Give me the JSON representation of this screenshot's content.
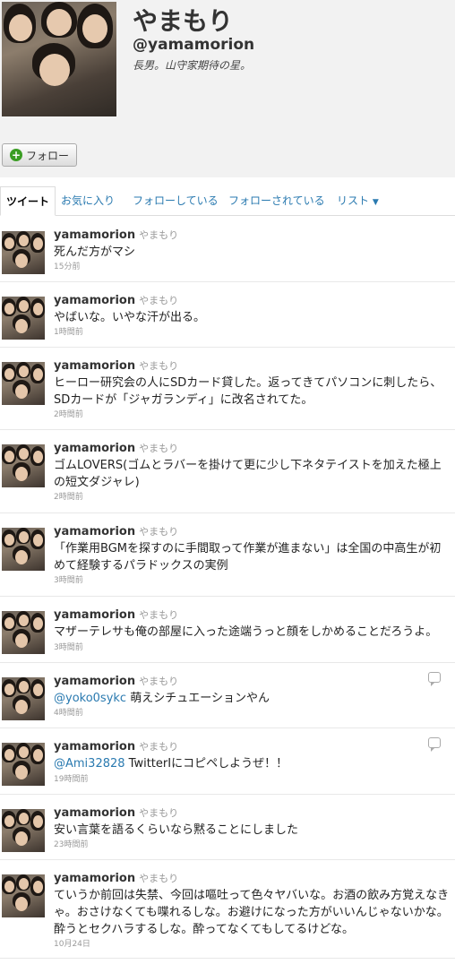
{
  "profile": {
    "display_name": "やまもり",
    "screen_name": "@yamamorion",
    "bio": "長男。山守家期待の星。",
    "follow_label": "フォロー"
  },
  "tabs": [
    "ツイート",
    "お気に入り",
    "フォローしている",
    "フォローされている",
    "リスト"
  ],
  "tweets": [
    {
      "username": "yamamorion",
      "name": "やまもり",
      "text": "死んだ方がマシ",
      "time": "15分前"
    },
    {
      "username": "yamamorion",
      "name": "やまもり",
      "text": "やばいな。いやな汗が出る。",
      "time": "1時間前"
    },
    {
      "username": "yamamorion",
      "name": "やまもり",
      "text": "ヒーロー研究会の人にSDカード貸した。返ってきてパソコンに刺したら、SDカードが「ジャガランディ」に改名されてた。",
      "time": "2時間前"
    },
    {
      "username": "yamamorion",
      "name": "やまもり",
      "text": "ゴムLOVERS(ゴムとラバーを掛けて更に少し下ネタテイストを加えた極上の短文ダジャレ)",
      "time": "2時間前"
    },
    {
      "username": "yamamorion",
      "name": "やまもり",
      "text": "「作業用BGMを探すのに手間取って作業が進まない」は全国の中高生が初めて経験するパラドックスの実例",
      "time": "3時間前"
    },
    {
      "username": "yamamorion",
      "name": "やまもり",
      "text": "マザーテレサも俺の部屋に入った途端うっと顔をしかめることだろうよ。",
      "time": "3時間前"
    },
    {
      "username": "yamamorion",
      "name": "やまもり",
      "mention": "@yoko0sykc",
      "text": " 萌えシチュエーションやん",
      "time": "4時間前"
    },
    {
      "username": "yamamorion",
      "name": "やまもり",
      "mention": "@Ami32828",
      "text": " TwitterIにコピペしようぜ！！",
      "time": "19時間前"
    },
    {
      "username": "yamamorion",
      "name": "やまもり",
      "text": "安い言葉を語るくらいなら黙ることにしました",
      "time": "23時間前"
    },
    {
      "username": "yamamorion",
      "name": "やまもり",
      "text": "ていうか前回は失禁、今回は嘔吐って色々ヤバいな。お酒の飲み方覚えなきゃ。おさけなくても喋れるしな。お避けになった方がいいんじゃないかな。酔うとセクハラするしな。酔ってなくてもしてるけどな。",
      "time": "10月24日"
    }
  ]
}
